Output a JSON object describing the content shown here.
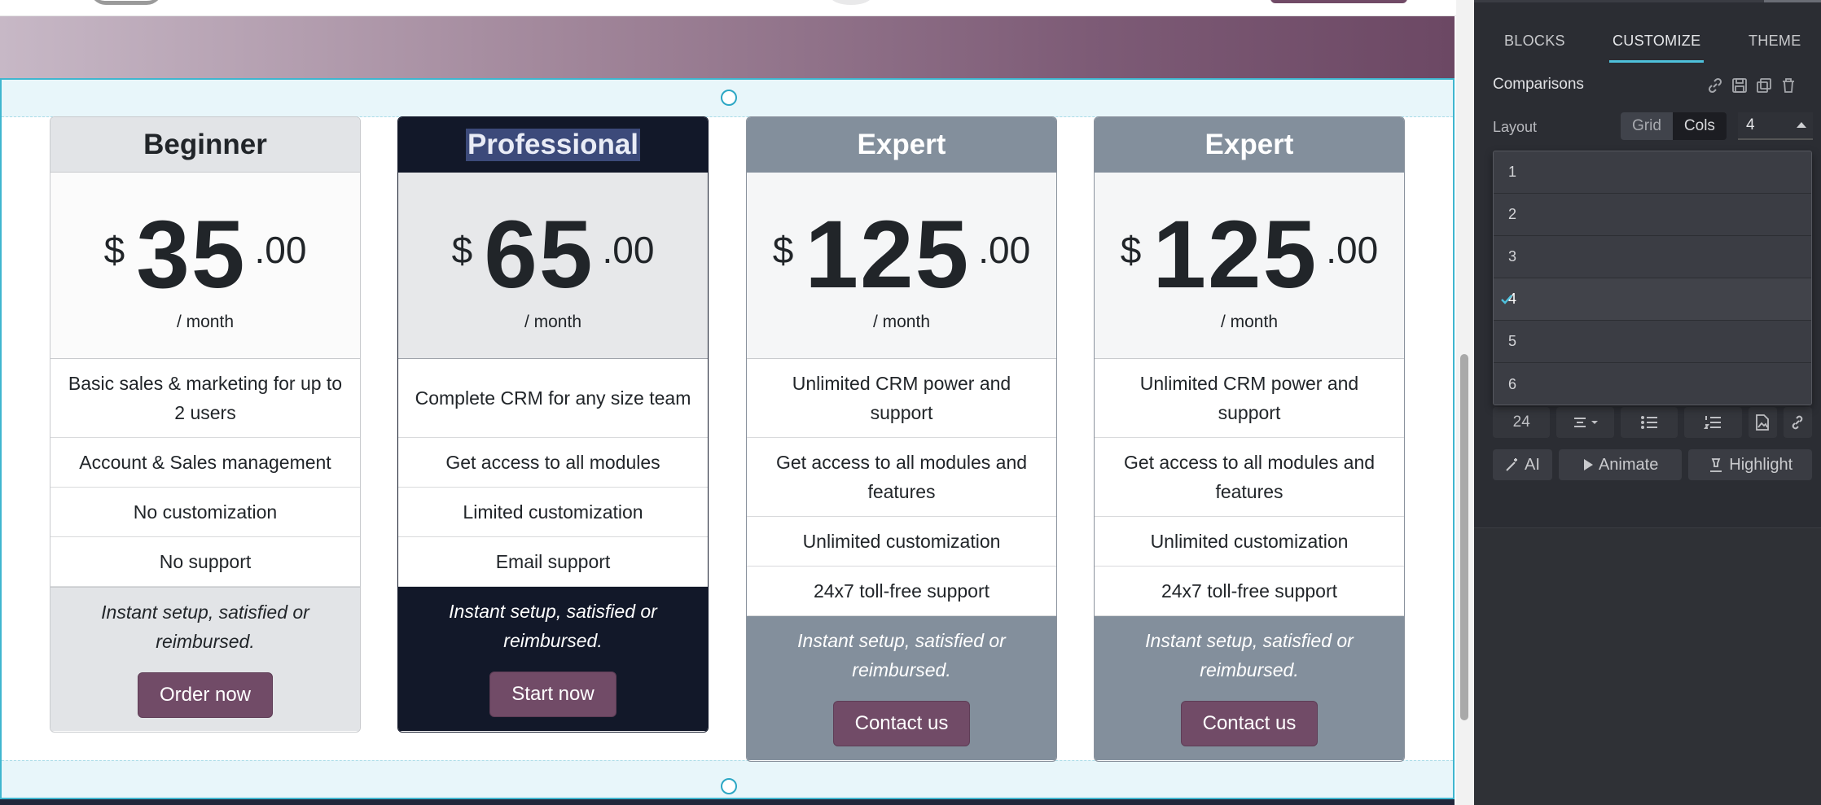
{
  "cards": [
    {
      "title": "Beginner",
      "currency": "$",
      "amount": "35",
      "cents": ".00",
      "period": "/ month",
      "features": [
        "Basic sales & marketing for up to 2 users",
        "Account & Sales management",
        "No customization",
        "No support"
      ],
      "note": "Instant setup, satisfied or reimbursed.",
      "button": "Order now"
    },
    {
      "title": "Professional",
      "currency": "$",
      "amount": "65",
      "cents": ".00",
      "period": "/ month",
      "features": [
        "Complete CRM for any size team",
        "Get access to all modules",
        "Limited customization",
        "Email support"
      ],
      "note": "Instant setup, satisfied or reimbursed.",
      "button": "Start now"
    },
    {
      "title": "Expert",
      "currency": "$",
      "amount": "125",
      "cents": ".00",
      "period": "/ month",
      "features": [
        "Unlimited CRM power and support",
        "Get access to all modules and features",
        "Unlimited customization",
        "24x7 toll-free support"
      ],
      "note": "Instant setup, satisfied or reimbursed.",
      "button": "Contact us"
    },
    {
      "title": "Expert",
      "currency": "$",
      "amount": "125",
      "cents": ".00",
      "period": "/ month",
      "features": [
        "Unlimited CRM power and support",
        "Get access to all modules and features",
        "Unlimited customization",
        "24x7 toll-free support"
      ],
      "note": "Instant setup, satisfied or reimbursed.",
      "button": "Contact us"
    }
  ],
  "panel": {
    "tabs": [
      "BLOCKS",
      "CUSTOMIZE",
      "THEME"
    ],
    "active_tab": "CUSTOMIZE",
    "section_title": "Comparisons",
    "tool_icons": [
      "link-icon",
      "save-icon",
      "duplicate-icon",
      "trash-icon"
    ],
    "layout": {
      "label": "Layout",
      "options": [
        "Grid",
        "Cols"
      ],
      "selected": "Cols",
      "cols_value": "4"
    },
    "cols_dropdown": {
      "items": [
        "1",
        "2",
        "3",
        "4",
        "5",
        "6"
      ],
      "selected": "4"
    },
    "text_row": {
      "font_size": "24"
    },
    "actions": [
      "AI",
      "Animate",
      "Highlight"
    ]
  },
  "colors": {
    "accent": "#714b67",
    "selection_outline": "#3fb6cf",
    "professional_header": "#121829",
    "expert_header": "#838f9c"
  }
}
